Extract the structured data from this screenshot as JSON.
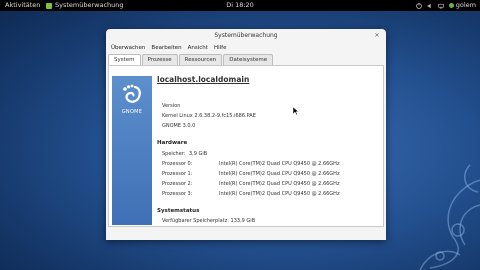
{
  "topbar": {
    "activities": "Aktivitäten",
    "app_name": "Systemüberwachung",
    "clock": "Di 18:20",
    "user": "golem"
  },
  "window": {
    "title": "Systemüberwachung",
    "menu": [
      "Überwachen",
      "Bearbeiten",
      "Ansicht",
      "Hilfe"
    ],
    "tabs": [
      "System",
      "Prozesse",
      "Ressourcen",
      "Dateisysteme"
    ],
    "active_tab": "System"
  },
  "system": {
    "logo_text": "GNOME",
    "hostname": "localhost.localdomain",
    "version_label": "Version",
    "kernel": "Kernel Linux 2.6.38.2-9.fc15.i686.PAE",
    "gnome_version": "GNOME 3.0.0",
    "hardware_title": "Hardware",
    "memory_label": "Speicher:",
    "memory_value": "3,9 GiB",
    "processors": [
      {
        "label": "Prozessor 0:",
        "value": "Intel(R) Core(TM)2 Quad  CPU   Q9450  @ 2.66GHz"
      },
      {
        "label": "Prozessor 1:",
        "value": "Intel(R) Core(TM)2 Quad  CPU   Q9450  @ 2.66GHz"
      },
      {
        "label": "Prozessor 2:",
        "value": "Intel(R) Core(TM)2 Quad  CPU   Q9450  @ 2.66GHz"
      },
      {
        "label": "Prozessor 3:",
        "value": "Intel(R) Core(TM)2 Quad  CPU   Q9450  @ 2.66GHz"
      }
    ],
    "status_title": "Systemstatus",
    "disk_free": "Verfügbarer Speicherplatz: 133,9 GiB"
  }
}
